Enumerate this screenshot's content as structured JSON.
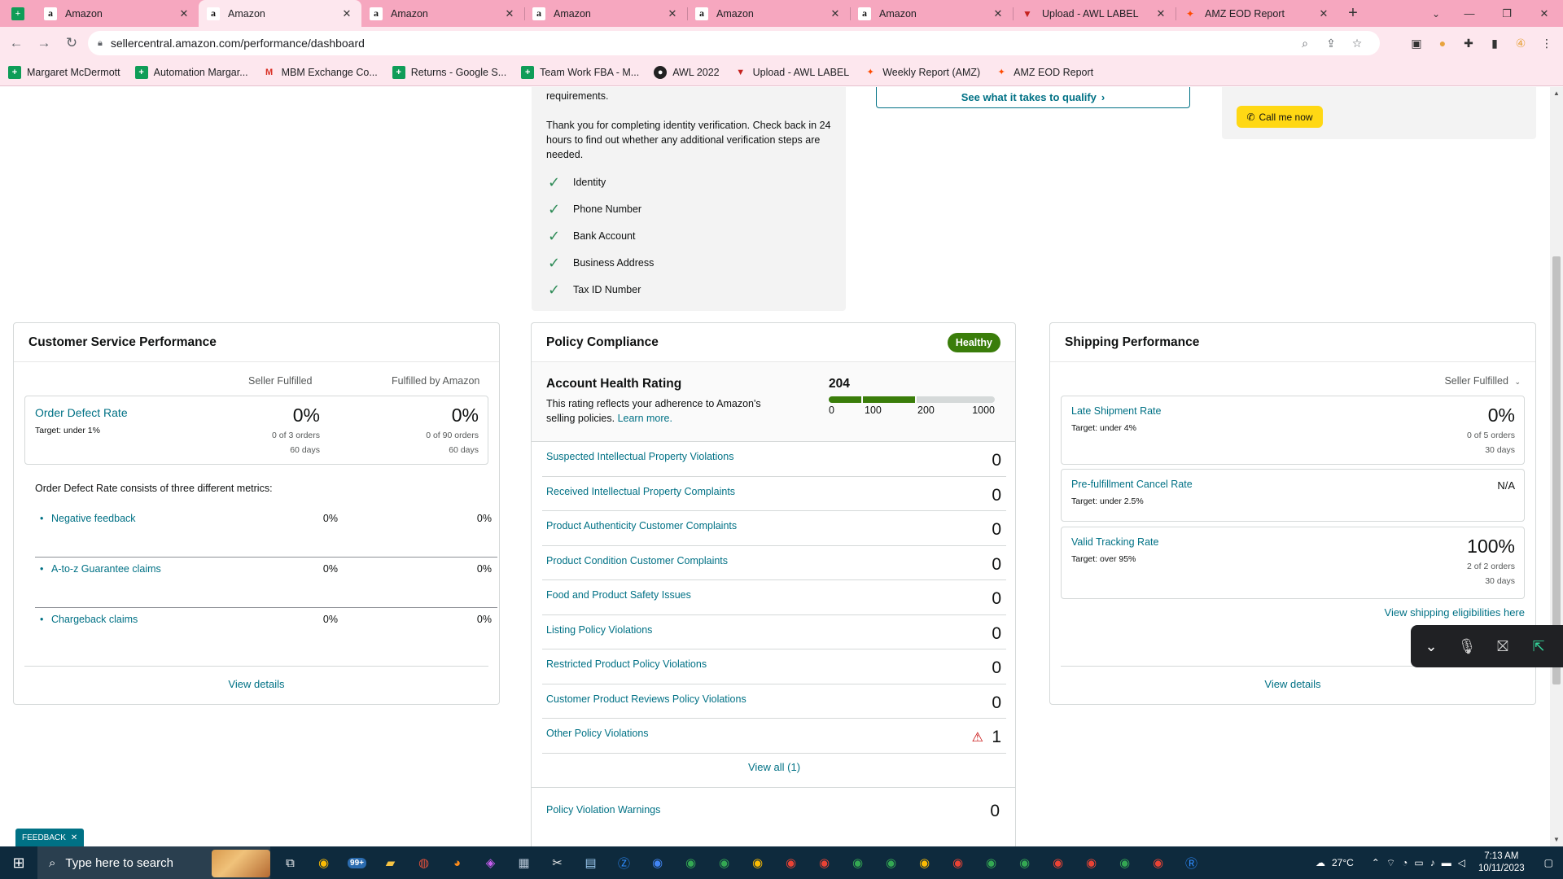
{
  "browser": {
    "tabs": [
      {
        "title": "Amazon",
        "icon": "amazon-icon",
        "active": false
      },
      {
        "title": "Amazon",
        "icon": "amazon-icon",
        "active": true
      },
      {
        "title": "Amazon",
        "icon": "amazon-icon",
        "active": false
      },
      {
        "title": "Amazon",
        "icon": "amazon-icon",
        "active": false
      },
      {
        "title": "Amazon",
        "icon": "amazon-icon",
        "active": false
      },
      {
        "title": "Amazon",
        "icon": "amazon-icon",
        "active": false
      },
      {
        "title": "Upload - AWL LABEL",
        "icon": "awl-icon",
        "active": false
      },
      {
        "title": "AMZ EOD Report",
        "icon": "zapier-icon",
        "active": false
      }
    ],
    "url": "sellercentral.amazon.com/performance/dashboard",
    "bookmarks": [
      {
        "label": "Margaret McDermott",
        "icon": "sheets-icon"
      },
      {
        "label": "Automation Margar...",
        "icon": "sheets-icon"
      },
      {
        "label": "MBM Exchange Co...",
        "icon": "gmail-icon"
      },
      {
        "label": "Returns - Google S...",
        "icon": "sheets-icon"
      },
      {
        "label": "Team Work FBA - M...",
        "icon": "sheets-icon"
      },
      {
        "label": "AWL 2022",
        "icon": "github-icon"
      },
      {
        "label": "Upload - AWL LABEL",
        "icon": "awl-icon"
      },
      {
        "label": "Weekly Report (AMZ)",
        "icon": "zapier-icon"
      },
      {
        "label": "AMZ EOD Report",
        "icon": "zapier-icon"
      }
    ]
  },
  "verification": {
    "requirements_text": "requirements.",
    "thanks_text": "Thank you for completing identity verification. Check back in 24 hours to find out whether any additional verification steps are needed.",
    "items": [
      "Identity",
      "Phone Number",
      "Bank Account",
      "Business Address",
      "Tax ID Number"
    ]
  },
  "qualify_link": "See what it takes to qualify",
  "call_button": "Call me now",
  "csp": {
    "title": "Customer Service Performance",
    "col1": "Seller Fulfilled",
    "col2": "Fulfilled by Amazon",
    "odr": {
      "name": "Order Defect Rate",
      "target": "Target: under 1%",
      "sf_value": "0%",
      "sf_orders": "0 of 3 orders",
      "sf_days": "60 days",
      "fba_value": "0%",
      "fba_orders": "0 of 90 orders",
      "fba_days": "60 days"
    },
    "note": "Order Defect Rate consists of three different metrics:",
    "metrics": [
      {
        "name": "Negative feedback",
        "sf": "0%",
        "fba": "0%"
      },
      {
        "name": "A-to-z Guarantee claims",
        "sf": "0%",
        "fba": "0%"
      },
      {
        "name": "Chargeback claims",
        "sf": "0%",
        "fba": "0%"
      }
    ],
    "view_details": "View details"
  },
  "policy": {
    "title": "Policy Compliance",
    "badge": "Healthy",
    "ahr_title": "Account Health Rating",
    "ahr_desc": "This rating reflects your adherence to Amazon's selling policies.",
    "learn_more": "Learn more.",
    "score": "204",
    "score_value": 204,
    "ticks": [
      "0",
      "100",
      "200",
      "1000"
    ],
    "rows": [
      {
        "name": "Suspected Intellectual Property Violations",
        "value": "0",
        "warn": false
      },
      {
        "name": "Received Intellectual Property Complaints",
        "value": "0",
        "warn": false
      },
      {
        "name": "Product Authenticity Customer Complaints",
        "value": "0",
        "warn": false
      },
      {
        "name": "Product Condition Customer Complaints",
        "value": "0",
        "warn": false
      },
      {
        "name": "Food and Product Safety Issues",
        "value": "0",
        "warn": false
      },
      {
        "name": "Listing Policy Violations",
        "value": "0",
        "warn": false
      },
      {
        "name": "Restricted Product Policy Violations",
        "value": "0",
        "warn": false
      },
      {
        "name": "Customer Product Reviews Policy Violations",
        "value": "0",
        "warn": false
      },
      {
        "name": "Other Policy Violations",
        "value": "1",
        "warn": true
      }
    ],
    "view_all": "View all (1)",
    "warnings_label": "Policy Violation Warnings",
    "warnings_value": "0"
  },
  "shipping": {
    "title": "Shipping Performance",
    "selector": "Seller Fulfilled",
    "metrics": [
      {
        "name": "Late Shipment Rate",
        "target": "Target: under 4%",
        "value": "0%",
        "orders": "0 of 5 orders",
        "days": "30 days"
      },
      {
        "name": "Pre-fulfillment Cancel Rate",
        "target": "Target: under 2.5%",
        "value": "N/A",
        "orders": "",
        "days": ""
      },
      {
        "name": "Valid Tracking Rate",
        "target": "Target: over 95%",
        "value": "100%",
        "orders": "2 of 2 orders",
        "days": "30 days"
      }
    ],
    "eligibility_link": "View shipping eligibilities here",
    "view_details": "View details"
  },
  "feedback": "FEEDBACK",
  "taskbar": {
    "search_placeholder": "Type here to search",
    "weather": "27°C",
    "time": "7:13 AM",
    "date": "10/11/2023",
    "mail_badge": "99+"
  }
}
